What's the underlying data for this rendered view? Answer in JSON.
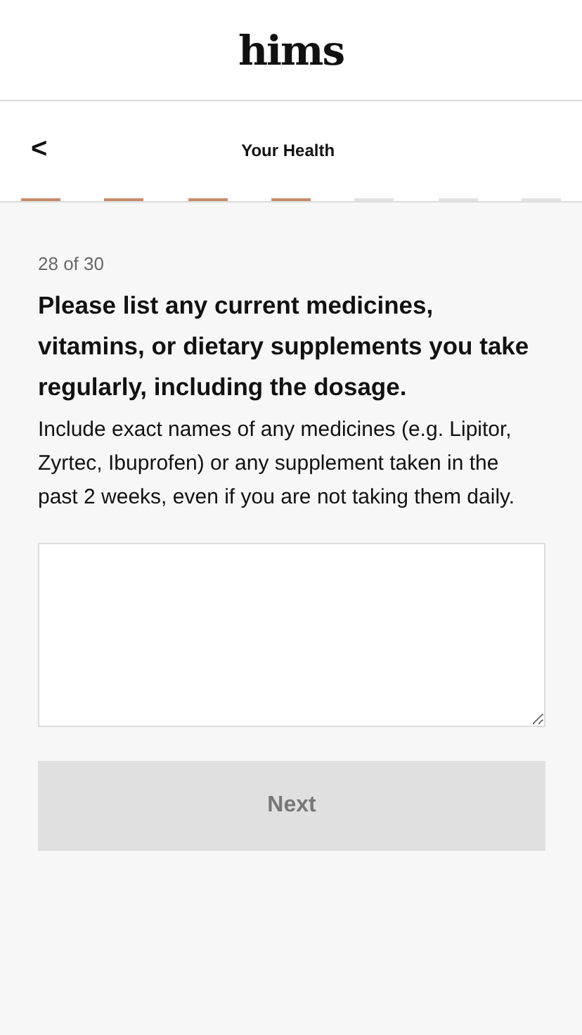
{
  "header": {
    "logo": "hims"
  },
  "nav": {
    "back": "<",
    "title": "Your Health"
  },
  "progress": [
    {
      "done": true
    },
    {
      "done": true
    },
    {
      "done": true
    },
    {
      "done": true
    },
    {
      "done": false
    },
    {
      "done": false
    },
    {
      "done": false
    }
  ],
  "question": {
    "counter": "28 of 30",
    "title": "Please list any current medicines, vitamins, or dietary supplements you take regularly, including the dosage.",
    "hint": "Include exact names of any medicines (e.g. Lipitor, Zyrtec, Ibuprofen) or any supplement taken in the past 2 weeks, even if you are not taking them daily."
  },
  "next_button": {
    "label": "Next",
    "disabled": true
  }
}
